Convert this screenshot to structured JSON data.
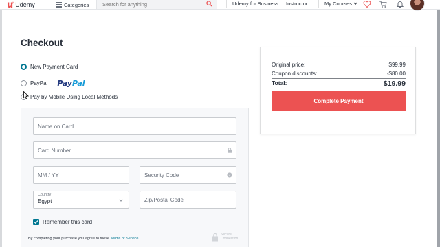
{
  "topnav": {
    "logo": "Udemy",
    "categories": "Categories",
    "search_placeholder": "Search for anything",
    "business": "Udemy for Business",
    "instructor": "Instructor",
    "my_courses": "My Courses"
  },
  "checkout": {
    "title": "Checkout",
    "payment_options": [
      {
        "label": "New Payment Card",
        "selected": true
      },
      {
        "label": "PayPal",
        "selected": false
      },
      {
        "label": "Pay by Mobile Using Local Methods",
        "selected": false
      }
    ],
    "paypal_logo": [
      "Pay",
      "Pal"
    ],
    "form": {
      "name_placeholder": "Name on Card",
      "card_placeholder": "Card Number",
      "expiry_placeholder": "MM / YY",
      "security_placeholder": "Security Code",
      "country_label": "Country",
      "country_value": "Egypt",
      "zip_placeholder": "Zip/Postal Code",
      "remember_label": "Remember this card",
      "remember_checked": true
    },
    "terms_text": "By completing your purchase you agree to these ",
    "terms_link": "Terms of Service.",
    "secure_text": "Secure Connection"
  },
  "summary": {
    "original_label": "Original price:",
    "original_value": "$99.99",
    "discount_label": "Coupon discounts:",
    "discount_value": "-$80.00",
    "total_label": "Total:",
    "total_value": "$19.99",
    "button_label": "Complete Payment"
  },
  "colors": {
    "brand": "#ec5252",
    "accent": "#007791",
    "paypal_dark": "#253b80",
    "paypal_light": "#179bd7"
  }
}
